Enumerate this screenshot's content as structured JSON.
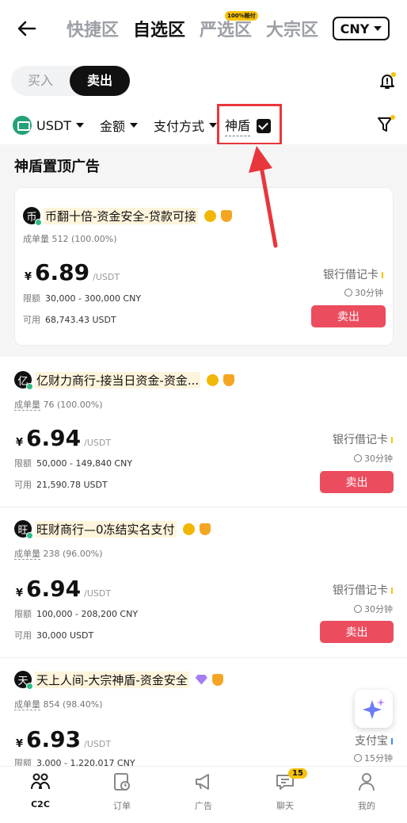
{
  "header": {
    "tabs": [
      {
        "label": "快捷区",
        "active": false
      },
      {
        "label": "自选区",
        "active": true
      },
      {
        "label": "严选区",
        "active": false,
        "badge": "100%赔付"
      },
      {
        "label": "大宗区",
        "active": false
      }
    ],
    "currency": "CNY"
  },
  "trade_toggle": {
    "buy": "买入",
    "sell": "卖出",
    "selected": "sell"
  },
  "filters": {
    "coin": "USDT",
    "amount": "金额",
    "payment": "支付方式",
    "shield": "神盾",
    "shield_checked": true
  },
  "section_title": "神盾置顶广告",
  "ads": [
    {
      "avatar": "币",
      "name": "币翻十倍-资金安全-贷款可接",
      "badge": "gold",
      "stats_label": "成单量",
      "stats": "512 (100.00%)",
      "currency_symbol": "¥",
      "price": "6.89",
      "unit": "/USDT",
      "limit_label": "限额",
      "limit": "30,000 - 300,000 CNY",
      "available_label": "可用",
      "available": "68,743.43 USDT",
      "payment": "银行借记卡",
      "time": "30分钟",
      "action": "卖出"
    },
    {
      "avatar": "亿",
      "name": "亿财力商行-接当日资金-资金...",
      "badge": "gold",
      "stats_label": "成单量",
      "stats": "76 (100.00%)",
      "currency_symbol": "¥",
      "price": "6.94",
      "unit": "/USDT",
      "limit_label": "限额",
      "limit": "50,000 - 149,840 CNY",
      "available_label": "可用",
      "available": "21,590.78 USDT",
      "payment": "银行借记卡",
      "time": "30分钟",
      "action": "卖出"
    },
    {
      "avatar": "旺",
      "name": "旺财商行—0冻结实名支付",
      "badge": "gold",
      "stats_label": "成单量",
      "stats": "238 (96.00%)",
      "currency_symbol": "¥",
      "price": "6.94",
      "unit": "/USDT",
      "limit_label": "限额",
      "limit": "100,000 - 208,200 CNY",
      "available_label": "可用",
      "available": "30,000 USDT",
      "payment": "银行借记卡",
      "time": "30分钟",
      "action": "卖出"
    },
    {
      "avatar": "天",
      "name": "天上人间-大宗神盾-资金安全",
      "badge": "diamond",
      "stats_label": "成单量",
      "stats": "854 (98.40%)",
      "currency_symbol": "¥",
      "price": "6.93",
      "unit": "/USDT",
      "limit_label": "限额",
      "limit": "3,000 - 1,220,017 CNY",
      "payment": "支付宝",
      "time": "15分钟"
    }
  ],
  "bottom_nav": [
    {
      "label": "C2C",
      "icon": "c2c-icon",
      "active": true
    },
    {
      "label": "订单",
      "icon": "order-icon",
      "active": false
    },
    {
      "label": "广告",
      "icon": "megaphone-icon",
      "active": false
    },
    {
      "label": "聊天",
      "icon": "chat-icon",
      "active": false,
      "badge": "15"
    },
    {
      "label": "我的",
      "icon": "profile-icon",
      "active": false
    }
  ],
  "colors": {
    "accent_red": "#eb4d5f",
    "highlight_box": "#e9363c",
    "badge_yellow": "#f7c20a"
  }
}
